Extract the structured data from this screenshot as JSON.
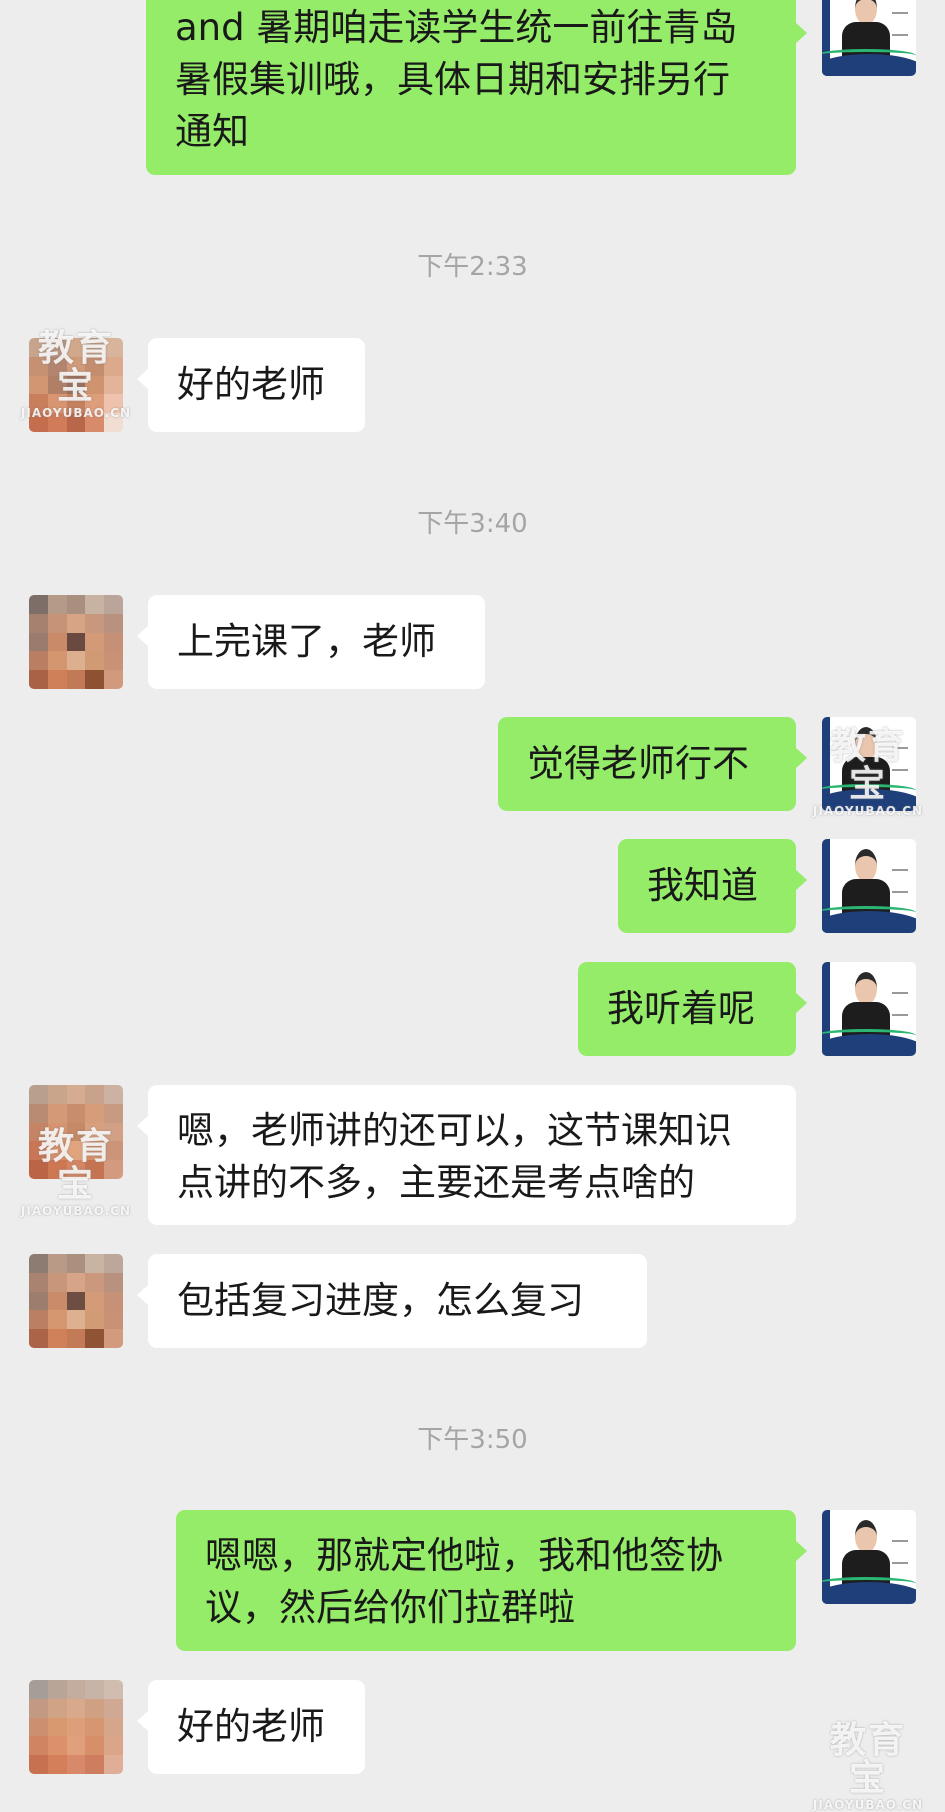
{
  "messages": [
    {
      "id": "m1",
      "side": "out",
      "lines": [
        "and 暑期咱走读学生统一前往青岛",
        "暑假集训哦，具体日期和安排另行",
        "通知"
      ]
    },
    {
      "time": "下午2:33"
    },
    {
      "id": "m2",
      "side": "in",
      "lines": [
        "好的老师"
      ]
    },
    {
      "time": "下午3:40"
    },
    {
      "id": "m3",
      "side": "in",
      "lines": [
        "上完课了，老师"
      ]
    },
    {
      "id": "m4",
      "side": "out",
      "lines": [
        "觉得老师行不"
      ]
    },
    {
      "id": "m5",
      "side": "out",
      "lines": [
        "我知道"
      ]
    },
    {
      "id": "m6",
      "side": "out",
      "lines": [
        "我听着呢"
      ]
    },
    {
      "id": "m7",
      "side": "in",
      "lines": [
        "嗯，老师讲的还可以，这节课知识",
        "点讲的不多，主要还是考点啥的"
      ]
    },
    {
      "id": "m8",
      "side": "in",
      "lines": [
        "包括复习进度，怎么复习"
      ]
    },
    {
      "time": "下午3:50"
    },
    {
      "id": "m9",
      "side": "out",
      "lines": [
        "嗯嗯，那就定他啦，我和他签协",
        "议，然后给你们拉群啦"
      ]
    },
    {
      "id": "m10",
      "side": "in",
      "lines": [
        "好的老师"
      ]
    }
  ],
  "timestamps": {
    "t1": "下午2:33",
    "t2": "下午3:40",
    "t3": "下午3:50"
  },
  "bubbles": {
    "m1": {
      "l1": "and 暑期咱走读学生统一前往青岛",
      "l2": "暑假集训哦，具体日期和安排另行",
      "l3": "通知"
    },
    "m2": {
      "l1": "好的老师"
    },
    "m3": {
      "l1": "上完课了，老师"
    },
    "m4": {
      "l1": "觉得老师行不"
    },
    "m5": {
      "l1": "我知道"
    },
    "m6": {
      "l1": "我听着呢"
    },
    "m7": {
      "l1": "嗯，老师讲的还可以，这节课知识",
      "l2": "点讲的不多，主要还是考点啥的"
    },
    "m8": {
      "l1": "包括复习进度，怎么复习"
    },
    "m9": {
      "l1": "嗯嗯，那就定他啦，我和他签协",
      "l2": "议，然后给你们拉群啦"
    },
    "m10": {
      "l1": "好的老师"
    }
  },
  "watermark": {
    "main": "教育宝",
    "sub": "JIAOYUBAO.CN"
  },
  "colors": {
    "background": "#ededed",
    "outgoing_bubble": "#95ec69",
    "incoming_bubble": "#ffffff",
    "timestamp_text": "#a5a5a5"
  }
}
